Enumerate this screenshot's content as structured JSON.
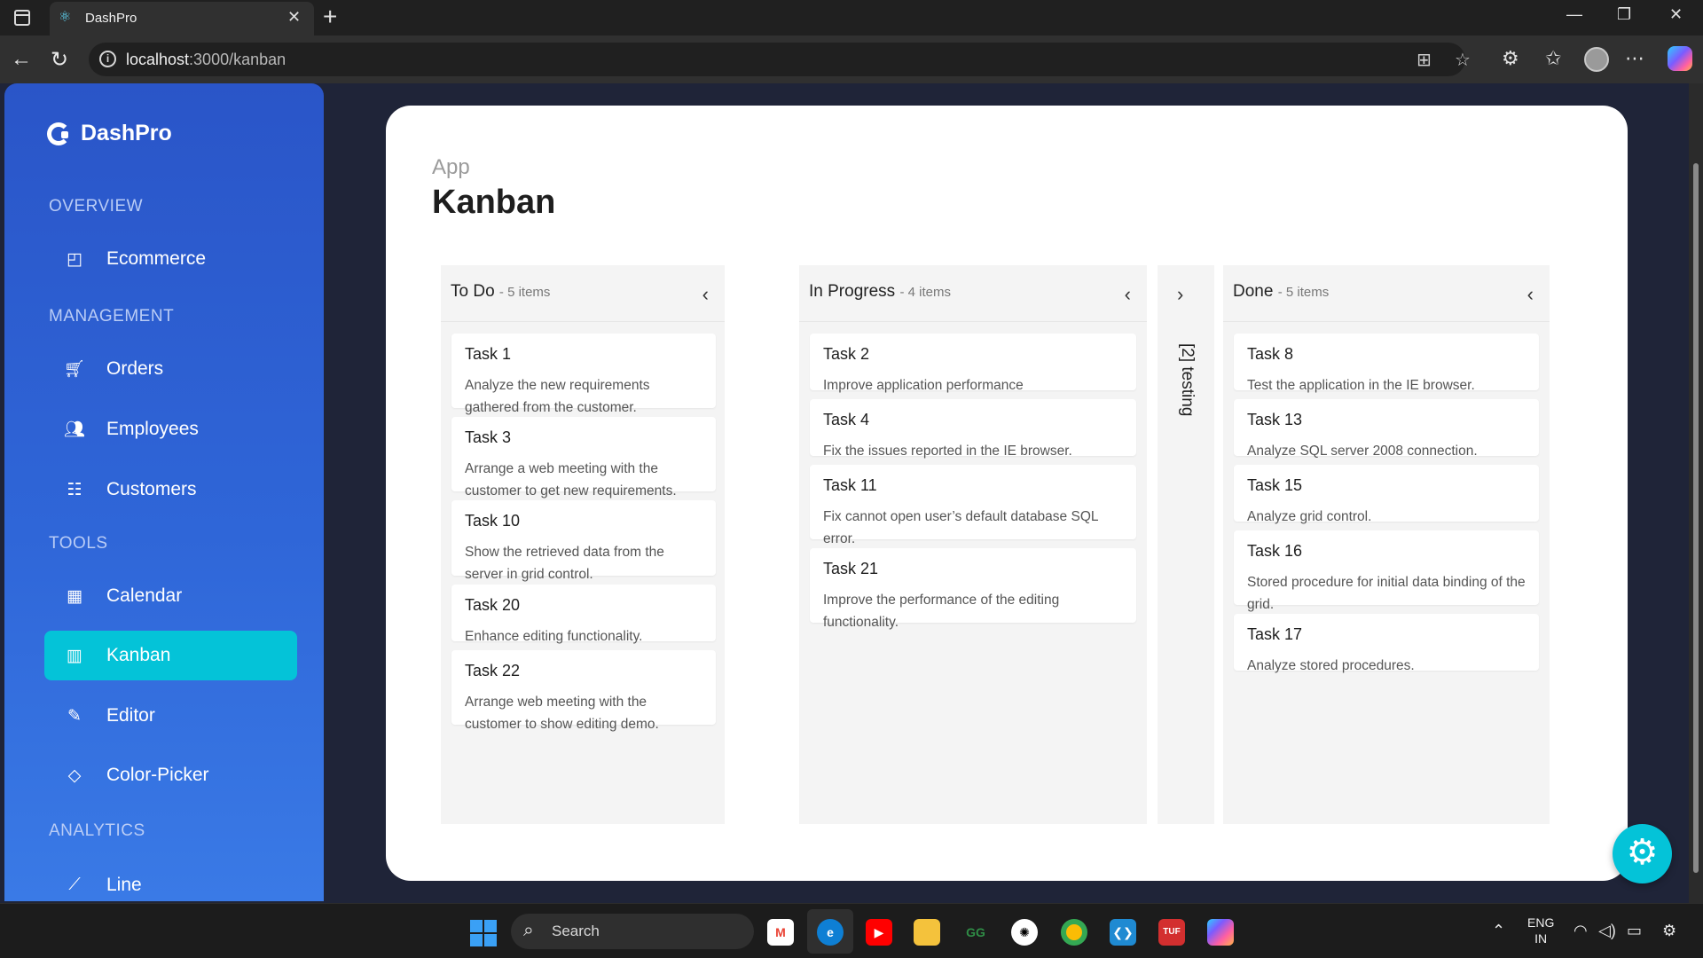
{
  "browser": {
    "tab_title": "DashPro",
    "url_host": "localhost",
    "url_path": ":3000/kanban"
  },
  "sidebar": {
    "brand": "DashPro",
    "sections": [
      {
        "title": "OVERVIEW",
        "items": [
          {
            "label": "Ecommerce",
            "icon": "shopping-bag-icon"
          }
        ]
      },
      {
        "title": "MANAGEMENT",
        "items": [
          {
            "label": "Orders",
            "icon": "cart-icon"
          },
          {
            "label": "Employees",
            "icon": "people-icon"
          },
          {
            "label": "Customers",
            "icon": "person-list-icon"
          }
        ]
      },
      {
        "title": "TOOLS",
        "items": [
          {
            "label": "Calendar",
            "icon": "calendar-icon"
          },
          {
            "label": "Kanban",
            "icon": "kanban-icon",
            "active": true
          },
          {
            "label": "Editor",
            "icon": "edit-icon"
          },
          {
            "label": "Color-Picker",
            "icon": "paint-bucket-icon"
          }
        ]
      },
      {
        "title": "ANALYTICS",
        "items": [
          {
            "label": "Line",
            "icon": "line-chart-icon"
          }
        ]
      }
    ]
  },
  "main": {
    "breadcrumb": "App",
    "title": "Kanban"
  },
  "kanban": {
    "columns": [
      {
        "title": "To Do",
        "count": "- 5 items",
        "cards": [
          {
            "title": "Task 1",
            "desc": "Analyze the new requirements gathered from the customer."
          },
          {
            "title": "Task 3",
            "desc": "Arrange a web meeting with the customer to get new requirements."
          },
          {
            "title": "Task 10",
            "desc": "Show the retrieved data from the server in grid control."
          },
          {
            "title": "Task 20",
            "desc": "Enhance editing functionality."
          },
          {
            "title": "Task 22",
            "desc": "Arrange web meeting with the customer to show editing demo."
          }
        ]
      },
      {
        "title": "In Progress",
        "count": "- 4 items",
        "cards": [
          {
            "title": "Task 2",
            "desc": "Improve application performance"
          },
          {
            "title": "Task 4",
            "desc": "Fix the issues reported in the IE browser."
          },
          {
            "title": "Task 11",
            "desc": "Fix cannot open user’s default database SQL error."
          },
          {
            "title": "Task 21",
            "desc": "Improve the performance of the editing functionality."
          }
        ]
      },
      {
        "title": "Done",
        "count": "- 5 items",
        "cards": [
          {
            "title": "Task 8",
            "desc": "Test the application in the IE browser."
          },
          {
            "title": "Task 13",
            "desc": "Analyze SQL server 2008 connection."
          },
          {
            "title": "Task 15",
            "desc": "Analyze grid control."
          },
          {
            "title": "Task 16",
            "desc": "Stored procedure for initial data binding of the grid."
          },
          {
            "title": "Task 17",
            "desc": "Analyze stored procedures."
          }
        ]
      }
    ],
    "collapsed_column": "[2] testing"
  },
  "taskbar": {
    "search_label": "Search",
    "lang_line1": "ENG",
    "lang_line2": "IN"
  },
  "colors": {
    "accent": "#04c3d8",
    "sidebar": "#2f66d8"
  }
}
